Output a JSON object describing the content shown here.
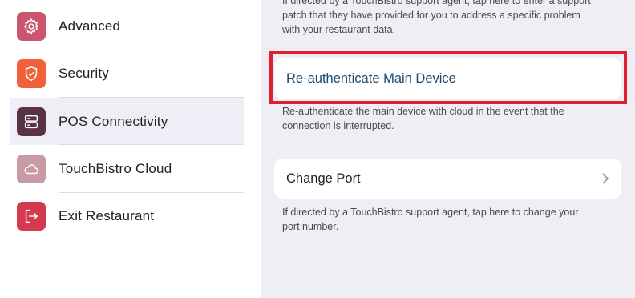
{
  "sidebar": {
    "items": [
      {
        "label": "Advanced",
        "icon": "gear-icon",
        "color": "#c9566d"
      },
      {
        "label": "Security",
        "icon": "shield-icon",
        "color": "#f0613a"
      },
      {
        "label": "POS Connectivity",
        "icon": "server-icon",
        "color": "#5a3246",
        "selected": true
      },
      {
        "label": "TouchBistro Cloud",
        "icon": "cloud-icon",
        "color": "#c99aa6"
      },
      {
        "label": "Exit Restaurant",
        "icon": "exit-icon",
        "color": "#d43a4e"
      }
    ]
  },
  "main": {
    "top_desc_line1": "If directed by a TouchBistro support agent, tap here to enter a support",
    "top_desc_line2": "patch that they have provided for you to address a specific problem",
    "top_desc_line3": "with your restaurant data.",
    "reauth": {
      "label": "Re-authenticate Main Device",
      "desc_line1": "Re-authenticate the main device with cloud in the event that the",
      "desc_line2": "connection is interrupted."
    },
    "change_port": {
      "label": "Change Port",
      "desc_line1": "If directed by a TouchBistro support agent, tap here to change your",
      "desc_line2": "port number."
    }
  },
  "colors": {
    "accent_link": "#1d4a6e",
    "highlight_border": "#e0202e",
    "panel_bg": "#f0eef5"
  }
}
